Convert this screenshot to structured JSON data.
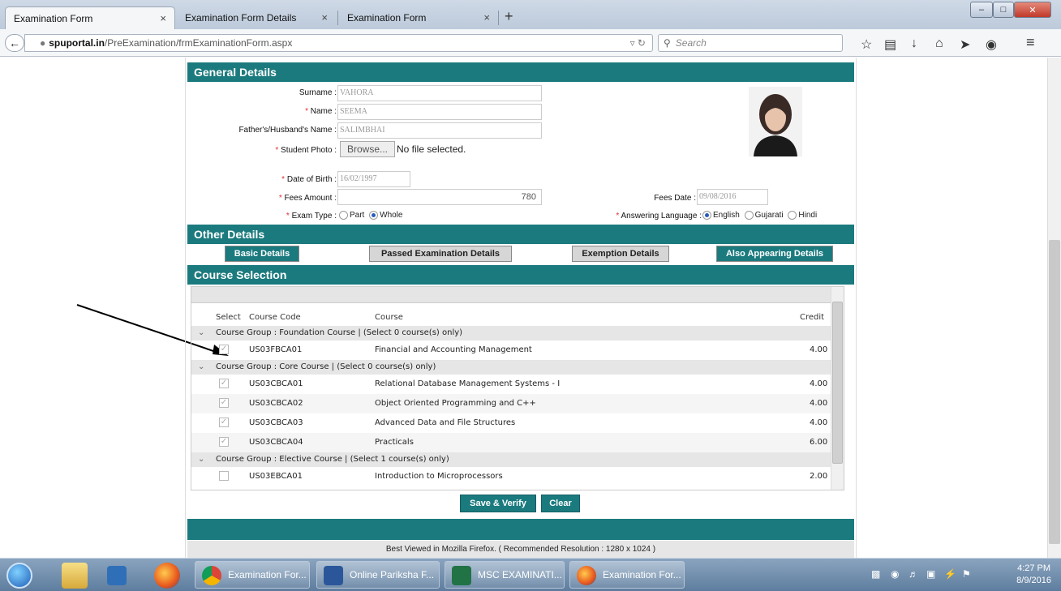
{
  "browser": {
    "tabs": [
      {
        "title": "Examination Form",
        "active": true
      },
      {
        "title": "Examination Form Details",
        "active": false
      },
      {
        "title": "Examination Form",
        "active": false
      }
    ],
    "url_host": "spuportal.in",
    "url_path": "/PreExamination/frmExaminationForm.aspx",
    "search_placeholder": "Search",
    "close_glyph": "×",
    "new_tab_glyph": "+"
  },
  "general": {
    "heading": "General Details",
    "surname_label": "Surname :",
    "surname_value": "VAHORA",
    "name_label": "Name :",
    "name_value": "SEEMA",
    "father_label": "Father's/Husband's Name :",
    "father_value": "SALIMBHAI",
    "photo_label": "Student Photo :",
    "browse_label": "Browse...",
    "no_file": "No file selected.",
    "dob_label": "Date of Birth :",
    "dob_value": "16/02/1997",
    "fees_label": "Fees Amount :",
    "fees_value": "780",
    "fees_date_label": "Fees Date :",
    "fees_date_value": "09/08/2016",
    "exam_type_label": "Exam Type :",
    "exam_type_options": [
      "Part",
      "Whole"
    ],
    "exam_type_selected": "Whole",
    "lang_label": "Answering Language :",
    "lang_options": [
      "English",
      "Gujarati",
      "Hindi"
    ],
    "lang_selected": "English",
    "required_mark": "*"
  },
  "other": {
    "heading": "Other Details",
    "tabs": [
      "Basic Details",
      "Passed Examination Details",
      "Exemption Details",
      "Also Appearing Details"
    ]
  },
  "course": {
    "heading": "Course Selection",
    "columns": {
      "select": "Select",
      "code": "Course Code",
      "course": "Course",
      "credit": "Credit"
    },
    "groups": [
      {
        "title": "Course Group : Foundation Course | (Select 0 course(s) only)",
        "rows": [
          {
            "code": "US03FBCA01",
            "course": "Financial and Accounting Management",
            "credit": "4.00",
            "checked": true
          }
        ]
      },
      {
        "title": "Course Group : Core Course | (Select 0 course(s) only)",
        "rows": [
          {
            "code": "US03CBCA01",
            "course": "Relational Database Management Systems - I",
            "credit": "4.00",
            "checked": true
          },
          {
            "code": "US03CBCA02",
            "course": "Object Oriented Programming and C++",
            "credit": "4.00",
            "checked": true
          },
          {
            "code": "US03CBCA03",
            "course": "Advanced Data and File Structures",
            "credit": "4.00",
            "checked": true
          },
          {
            "code": "US03CBCA04",
            "course": "Practicals",
            "credit": "6.00",
            "checked": true
          }
        ]
      },
      {
        "title": "Course Group : Elective Course | (Select 1 course(s) only)",
        "rows": [
          {
            "code": "US03EBCA01",
            "course": "Introduction to Microprocessors",
            "credit": "2.00",
            "checked": false
          }
        ]
      }
    ],
    "save_label": "Save & Verify",
    "clear_label": "Clear"
  },
  "footer_text": "Best Viewed in Mozilla Firefox. ( Recommended Resolution : 1280 x 1024 )",
  "taskbar": {
    "tasks": [
      "Examination For...",
      "Online Pariksha F...",
      "MSC EXAMINATI...",
      "Examination For..."
    ],
    "time": "4:27 PM",
    "date": "8/9/2016"
  },
  "colors": {
    "teal": "#1b7a7e",
    "required": "#e03030"
  }
}
